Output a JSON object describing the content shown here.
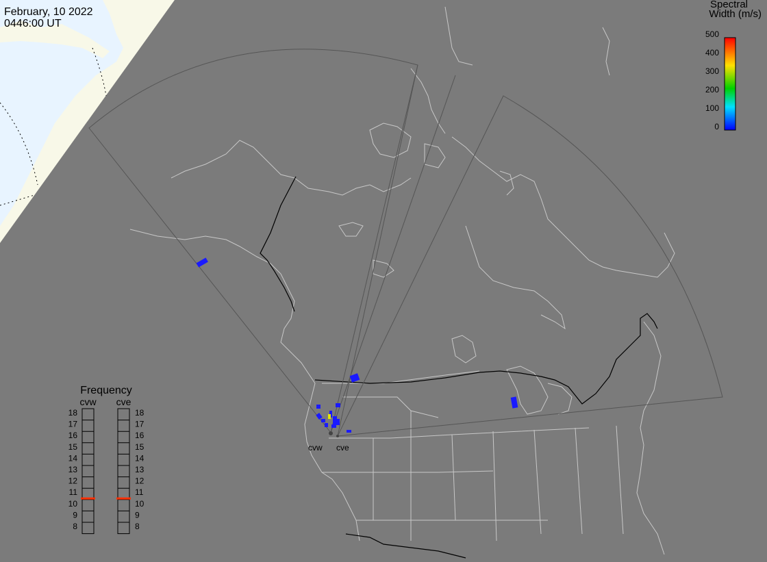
{
  "header": {
    "date": "February, 10 2022",
    "time": "0446:00 UT"
  },
  "legend": {
    "title_line1": "Spectral",
    "title_line2": "Width (m/s)",
    "ticks": [
      "500",
      "400",
      "300",
      "200",
      "100",
      "0"
    ],
    "colors": {
      "low": "#0000ff",
      "mid_low": "#00e0ff",
      "mid": "#00d000",
      "mid_high": "#ffe000",
      "high": "#ff0000"
    }
  },
  "frequency": {
    "title": "Frequency",
    "radars": [
      {
        "name": "cvw",
        "value": 10.6
      },
      {
        "name": "cve",
        "value": 10.6
      }
    ],
    "ticks": [
      "18",
      "17",
      "16",
      "15",
      "14",
      "13",
      "12",
      "11",
      "10",
      "9",
      "8"
    ],
    "marker_color": "#ff3000"
  },
  "map": {
    "radar_labels": [
      "cvw",
      "cve"
    ],
    "land_color": "#7b7b7b",
    "daylight_color": "#f8f8e8",
    "sea_color": "#e8f4ff",
    "coast_color": "#c8c8c8",
    "border_color": "#000000",
    "scatter_color": "#1a1aff",
    "scatter_high_color": "#e8e800"
  }
}
